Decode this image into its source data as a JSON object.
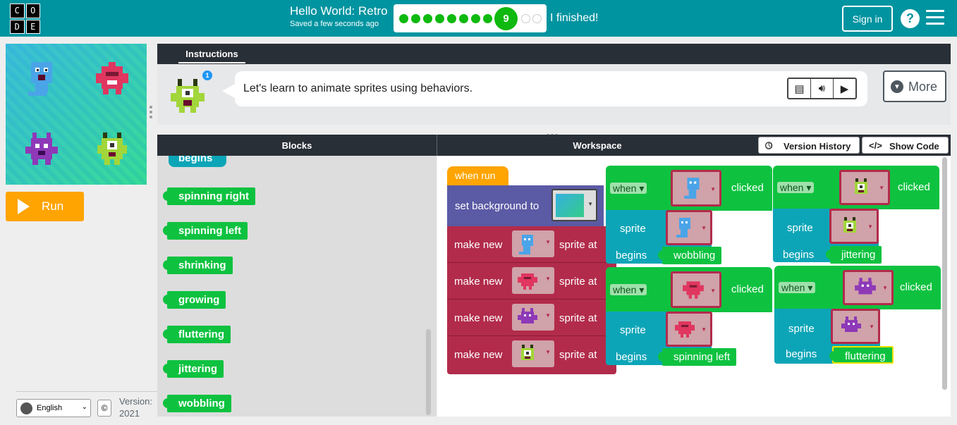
{
  "header": {
    "logo_letters": [
      "C",
      "O",
      "D",
      "E"
    ],
    "title": "Hello World: Retro",
    "saved": "Saved a few seconds ago",
    "progress": {
      "completed_levels": 8,
      "current_level": "9",
      "remaining_levels": 2
    },
    "finished_label": "I finished!",
    "sign_in": "Sign in",
    "help": "?"
  },
  "stage": {
    "run_label": "Run"
  },
  "footer": {
    "language": "English",
    "copyright": "©",
    "version_label": "Version:",
    "version_year": "2021"
  },
  "instructions": {
    "tab": "Instructions",
    "text": "Let's learn to animate sprites using behaviors.",
    "hint_count": "1",
    "more_label": "More"
  },
  "code": {
    "blocks_header": "Blocks",
    "workspace_header": "Workspace",
    "version_history": "Version History",
    "show_code": "Show Code"
  },
  "toolbox": {
    "partial_label": "begins",
    "behaviors": [
      "spinning right",
      "spinning left",
      "shrinking",
      "growing",
      "fluttering",
      "jittering",
      "wobbling"
    ]
  },
  "workspace": {
    "when_run": "when run",
    "set_background": "set background to",
    "make_new": "make new",
    "sprite_at": "sprite at",
    "when": "when",
    "clicked": "clicked",
    "sprite": "sprite",
    "begins": "begins",
    "behaviors_used": [
      "wobbling",
      "jittering",
      "spinning left",
      "fluttering"
    ]
  },
  "colors": {
    "header_bg": "#0094a0",
    "run_button": "#ffa400",
    "event_green": "#0ec240",
    "sprite_teal": "#0ca5b7",
    "make_sprite_red": "#b22b4b",
    "when_run_orange": "#ffa400",
    "background_block": "#5b5aa5",
    "progress_green": "#0fb90f"
  },
  "sprites": [
    {
      "name": "blue-ghost-icon",
      "color": "#4aa4e8"
    },
    {
      "name": "red-monster-icon",
      "color": "#e0365f"
    },
    {
      "name": "purple-monster-icon",
      "color": "#8e39b8"
    },
    {
      "name": "green-alien-icon",
      "color": "#a2d63a"
    }
  ]
}
